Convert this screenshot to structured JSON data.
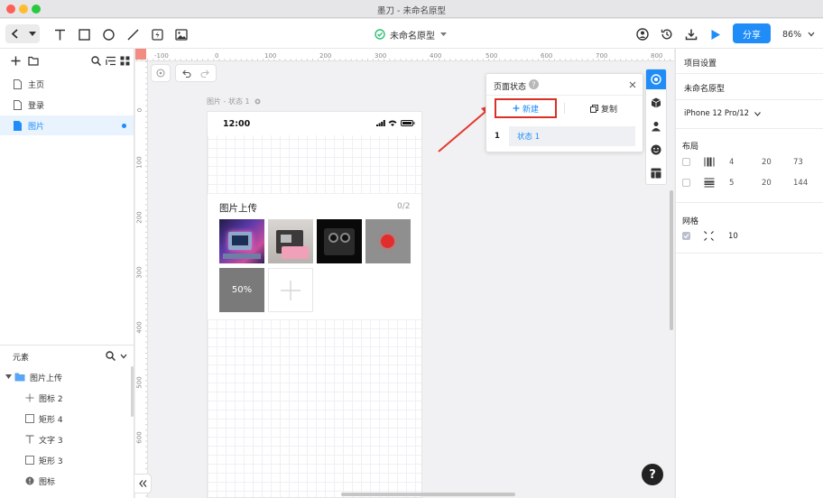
{
  "window": {
    "title": "墨刀 - 未命名原型"
  },
  "toolbar": {
    "doc_name": "未命名原型",
    "share_label": "分享",
    "zoom": "86%",
    "accent": "#1f8cf8"
  },
  "pages": {
    "items": [
      {
        "label": "主页",
        "active": false
      },
      {
        "label": "登录",
        "active": false
      },
      {
        "label": "图片",
        "active": true
      }
    ]
  },
  "elements": {
    "title": "元素",
    "items": [
      {
        "label": "图片上传",
        "icon": "folder-icon",
        "indent": 0
      },
      {
        "label": "图标 2",
        "icon": "plus-icon",
        "indent": 1
      },
      {
        "label": "矩形 4",
        "icon": "rect-icon",
        "indent": 1
      },
      {
        "label": "文字 3",
        "icon": "text-icon",
        "indent": 1
      },
      {
        "label": "矩形 3",
        "icon": "rect-icon",
        "indent": 1
      },
      {
        "label": "图标",
        "icon": "info-icon",
        "indent": 1
      }
    ]
  },
  "canvas": {
    "ruler_h": [
      "-100",
      "0",
      "100",
      "200",
      "300",
      "400",
      "500",
      "600",
      "700",
      "800"
    ],
    "ruler_v": [
      "0",
      "100",
      "200",
      "300",
      "400",
      "500",
      "600"
    ],
    "frame_label": "图片 - 状态 1"
  },
  "phone": {
    "time": "12:00",
    "upload": {
      "title": "图片上传",
      "count": "0/2",
      "progress": "50%"
    }
  },
  "state_panel": {
    "title": "页面状态",
    "new_label": "新建",
    "copy_label": "复制",
    "states": [
      {
        "index": "1",
        "name": "状态 1"
      }
    ]
  },
  "right_panel": {
    "title": "项目设置",
    "project_name": "未命名原型",
    "device": "iPhone 12 Pro/12",
    "layout_title": "布局",
    "layout_rows": [
      {
        "a": "4",
        "b": "20",
        "c": "73"
      },
      {
        "a": "5",
        "b": "20",
        "c": "144"
      }
    ],
    "grid_title": "网格",
    "grid_value": "10"
  },
  "help": {
    "label": "?"
  }
}
